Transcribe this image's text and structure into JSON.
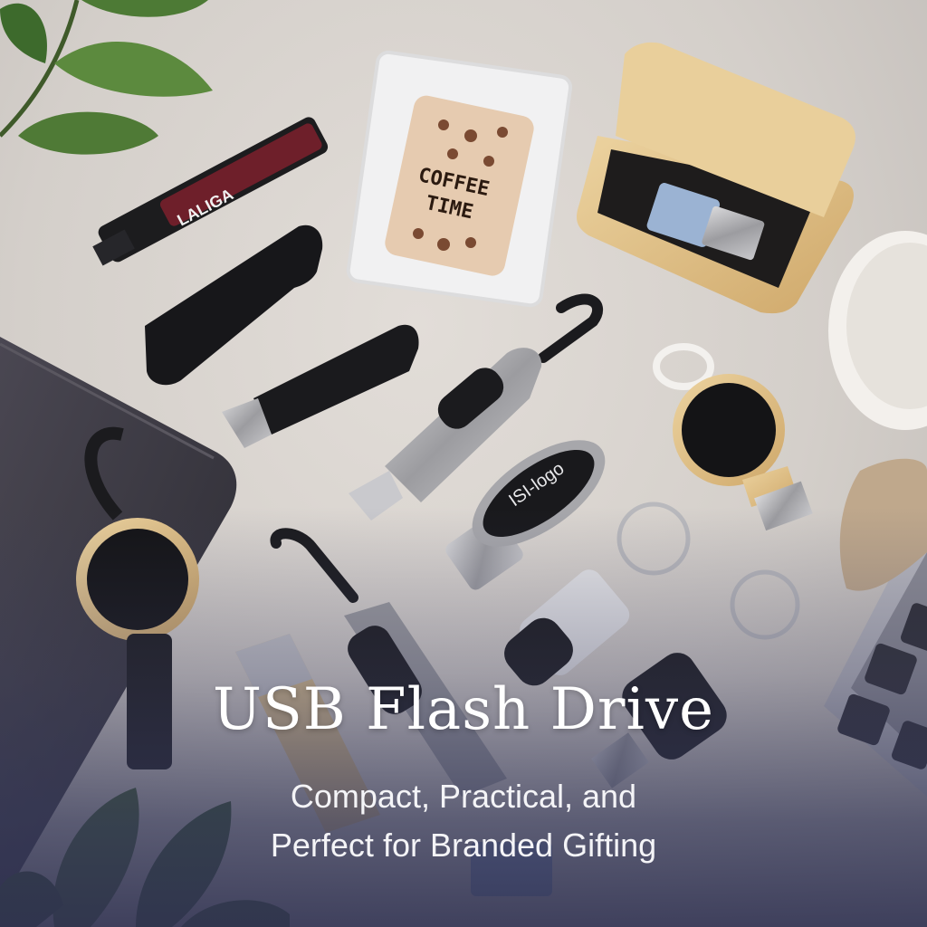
{
  "photo": {
    "items": {
      "swivel_drive_label": "LALIGA",
      "card_drive_label_line1": "COFFEE",
      "card_drive_label_line2": "TIME",
      "oval_drive_label": "ISI-logo"
    },
    "colors": {
      "desk": "#d6d1cc",
      "wood": "#e2c58e",
      "overlay": "#34375a",
      "text": "#ffffff"
    }
  },
  "overlay_text": {
    "title": "USB Flash Drive",
    "subtitle_line1": "Compact, Practical, and",
    "subtitle_line2": "Perfect for Branded Gifting"
  }
}
